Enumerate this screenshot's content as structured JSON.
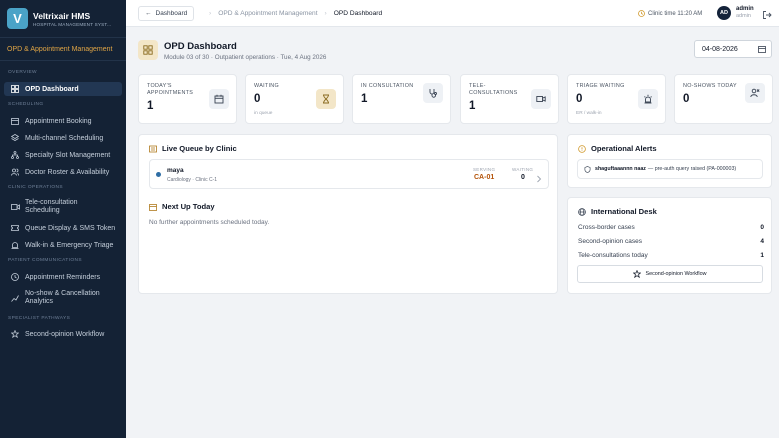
{
  "app": {
    "name": "Veltrixair HMS",
    "subtitle": "HOSPITAL MANAGEMENT SYST...",
    "logo_letter": "V"
  },
  "sidebar": {
    "module_title": "OPD & Appointment Management",
    "sections": {
      "overview": "OVERVIEW",
      "scheduling": "SCHEDULING",
      "clinic_ops": "CLINIC OPERATIONS",
      "patient_comms": "PATIENT COMMUNICATIONS",
      "specialist": "SPECIALIST PATHWAYS"
    },
    "items": {
      "opd_dashboard": "OPD Dashboard",
      "appointment_booking": "Appointment Booking",
      "multichannel": "Multi-channel Scheduling",
      "specialty_slot": "Specialty Slot Management",
      "doctor_roster": "Doctor Roster & Availability",
      "teleconsult": "Tele-consultation Scheduling",
      "queue_display": "Queue Display & SMS Token",
      "walkin_triage": "Walk-in & Emergency Triage",
      "reminders": "Appointment Reminders",
      "noshow": "No-show & Cancellation Analytics",
      "second_opinion": "Second-opinion Workflow"
    }
  },
  "topbar": {
    "back_label": "Dashboard",
    "breadcrumb_parent": "OPD & Appointment Management",
    "breadcrumb_current": "OPD Dashboard",
    "clinic_time": "Clinic time 11:20 AM",
    "avatar_initials": "AD",
    "user_name": "admin",
    "user_role": "admin"
  },
  "page": {
    "title": "OPD Dashboard",
    "subtitle": "Module 03 of 30 · Outpatient operations · Tue, 4 Aug 2026",
    "date_value": "04-08-2026"
  },
  "kpis": {
    "today": {
      "label": "TODAY'S APPOINTMENTS",
      "value": "1",
      "icon": "calendar-icon"
    },
    "waiting": {
      "label": "WAITING",
      "value": "0",
      "note": "in queue",
      "icon": "hourglass-icon"
    },
    "in_consultation": {
      "label": "IN CONSULTATION",
      "value": "1",
      "icon": "stethoscope-icon"
    },
    "tele": {
      "label": "TELE-CONSULTATIONS",
      "value": "1",
      "icon": "video-icon"
    },
    "triage": {
      "label": "TRIAGE WAITING",
      "value": "0",
      "note": "ER / walk-in",
      "icon": "siren-icon"
    },
    "noshows": {
      "label": "NO-SHOWS TODAY",
      "value": "0",
      "icon": "user-x-icon"
    }
  },
  "live_queue": {
    "title": "Live Queue by Clinic",
    "item": {
      "name": "maya",
      "sub": "Cardiology · Clinic C-1",
      "serving_label": "SERVING",
      "serving_value": "CA-01",
      "waiting_label": "WAITING",
      "waiting_value": "0"
    }
  },
  "next_up": {
    "title": "Next Up Today",
    "empty": "No further appointments scheduled today."
  },
  "alerts": {
    "title": "Operational Alerts",
    "item_name": "shaguftaaannn naaz",
    "item_text": "— pre-auth query raised (PA-000003)"
  },
  "intl_desk": {
    "title": "International Desk",
    "rows": [
      {
        "label": "Cross-border cases",
        "value": "0"
      },
      {
        "label": "Second-opinion cases",
        "value": "4"
      },
      {
        "label": "Tele-consultations today",
        "value": "1"
      }
    ],
    "button": "Second-opinion Workflow"
  },
  "colors": {
    "sidebar_bg": "#142235",
    "accent_gold": "#e0a545",
    "serving_color": "#b45309"
  }
}
